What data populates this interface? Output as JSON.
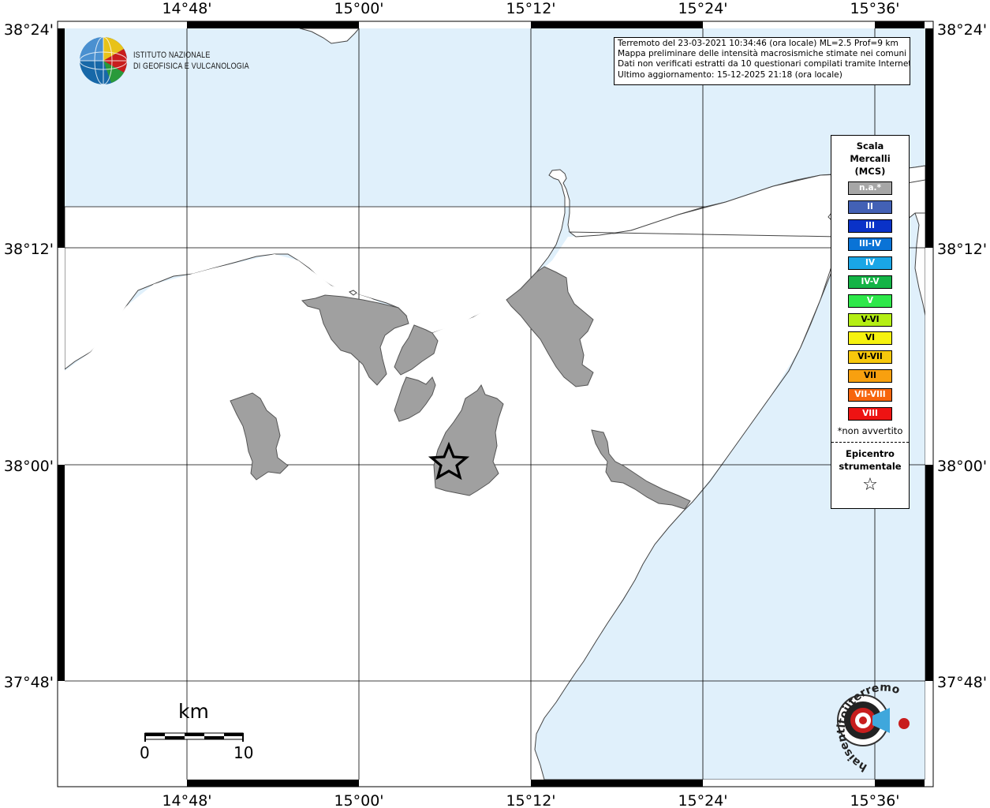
{
  "map": {
    "lat_labels": [
      "38°24'",
      "38°12'",
      "38°00'",
      "37°48'"
    ],
    "lon_labels": [
      "14°48'",
      "15°00'",
      "15°12'",
      "15°24'",
      "15°36'"
    ]
  },
  "logo": {
    "line1": "ISTITUTO NAZIONALE",
    "line2": "DI GEOFISICA E VULCANOLOGIA"
  },
  "info": {
    "line1": "Terremoto del 23-03-2021 10:34:46 (ora locale) ML=2.5 Prof=9 km",
    "line2": "Mappa preliminare delle intensità macrosismiche stimate nei comuni",
    "line3": "Dati non verificati estratti da 10 questionari compilati tramite Internet.",
    "line4": "Ultimo aggiornamento: 15-12-2025 21:18 (ora locale)"
  },
  "legend": {
    "title1": "Scala",
    "title2": "Mercalli",
    "title3": "(MCS)",
    "items": [
      {
        "label": "n.a.*",
        "color": "#a6a6a6"
      },
      {
        "label": "II",
        "color": "#4361b5"
      },
      {
        "label": "III",
        "color": "#0a32c8"
      },
      {
        "label": "III-IV",
        "color": "#0a73d6"
      },
      {
        "label": "IV",
        "color": "#1aa6e6"
      },
      {
        "label": "IV-V",
        "color": "#14b446"
      },
      {
        "label": "V",
        "color": "#2ee84a"
      },
      {
        "label": "V-VI",
        "color": "#b4ee14"
      },
      {
        "label": "VI",
        "color": "#f6f20f"
      },
      {
        "label": "VI-VII",
        "color": "#f7c80c"
      },
      {
        "label": "VII",
        "color": "#f8a00f"
      },
      {
        "label": "VII-VIII",
        "color": "#f7650d"
      },
      {
        "label": "VIII",
        "color": "#ee1313"
      }
    ],
    "note": "*non avvertito",
    "epicenter1": "Epicentro",
    "epicenter2": "strumentale",
    "star": "☆"
  },
  "scale": {
    "unit": "km",
    "start": "0",
    "end": "10"
  },
  "watermark": {
    "text": "haisentitoilterremoto.it"
  },
  "colors": {
    "sea": "#e0f0fb",
    "land": "#ffffff",
    "municipality": "#a0a0a0"
  }
}
